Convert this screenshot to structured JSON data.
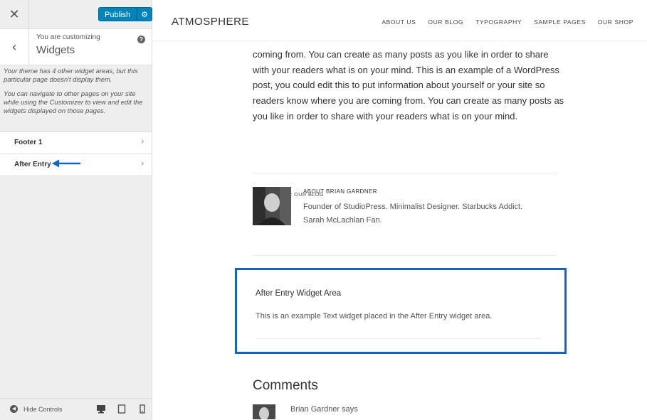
{
  "sidebar": {
    "close_icon": "close-icon",
    "publish_label": "Publish",
    "gear_icon": "gear-icon",
    "customizing_label": "You are customizing",
    "section_title": "Widgets",
    "back_icon": "chevron-left-icon",
    "help_icon": "help-icon",
    "description": [
      "Your theme has 4 other widget areas, but this particular page doesn't display them.",
      "You can navigate to other pages on your site while using the Customizer to view and edit the widgets displayed on those pages."
    ],
    "items": [
      {
        "label": "Footer 1"
      },
      {
        "label": "After Entry"
      }
    ],
    "hide_controls_label": "Hide Controls",
    "devices": [
      "desktop-icon",
      "tablet-icon",
      "mobile-icon"
    ],
    "arrow_color": "#1565c0"
  },
  "site": {
    "title": "ATMOSPHERE",
    "nav": [
      "ABOUT US",
      "OUR BLOG",
      "TYPOGRAPHY",
      "SAMPLE PAGES",
      "OUR SHOP"
    ],
    "body_text": "coming from. You can create as many posts as you like in order to share with your readers what is on your mind. This is an example of a WordPress post, you could edit this to put information about yourself or your site so readers know where you are coming from. You can create as many posts as you like in order to share with your readers what is on your mind.",
    "filed_under": "FILED UNDER: OUR BLOG",
    "author": {
      "heading": "ABOUT BRIAN GARDNER",
      "bio": "Founder of StudioPress. Minimalist Designer. Starbucks Addict. Sarah McLachlan Fan."
    },
    "widget": {
      "title": "After Entry Widget Area",
      "text": "This is an example Text widget placed in the After Entry widget area.",
      "highlight_color": "#1565c0"
    },
    "comments_title": "Comments",
    "commenter": "Brian Gardner says"
  }
}
